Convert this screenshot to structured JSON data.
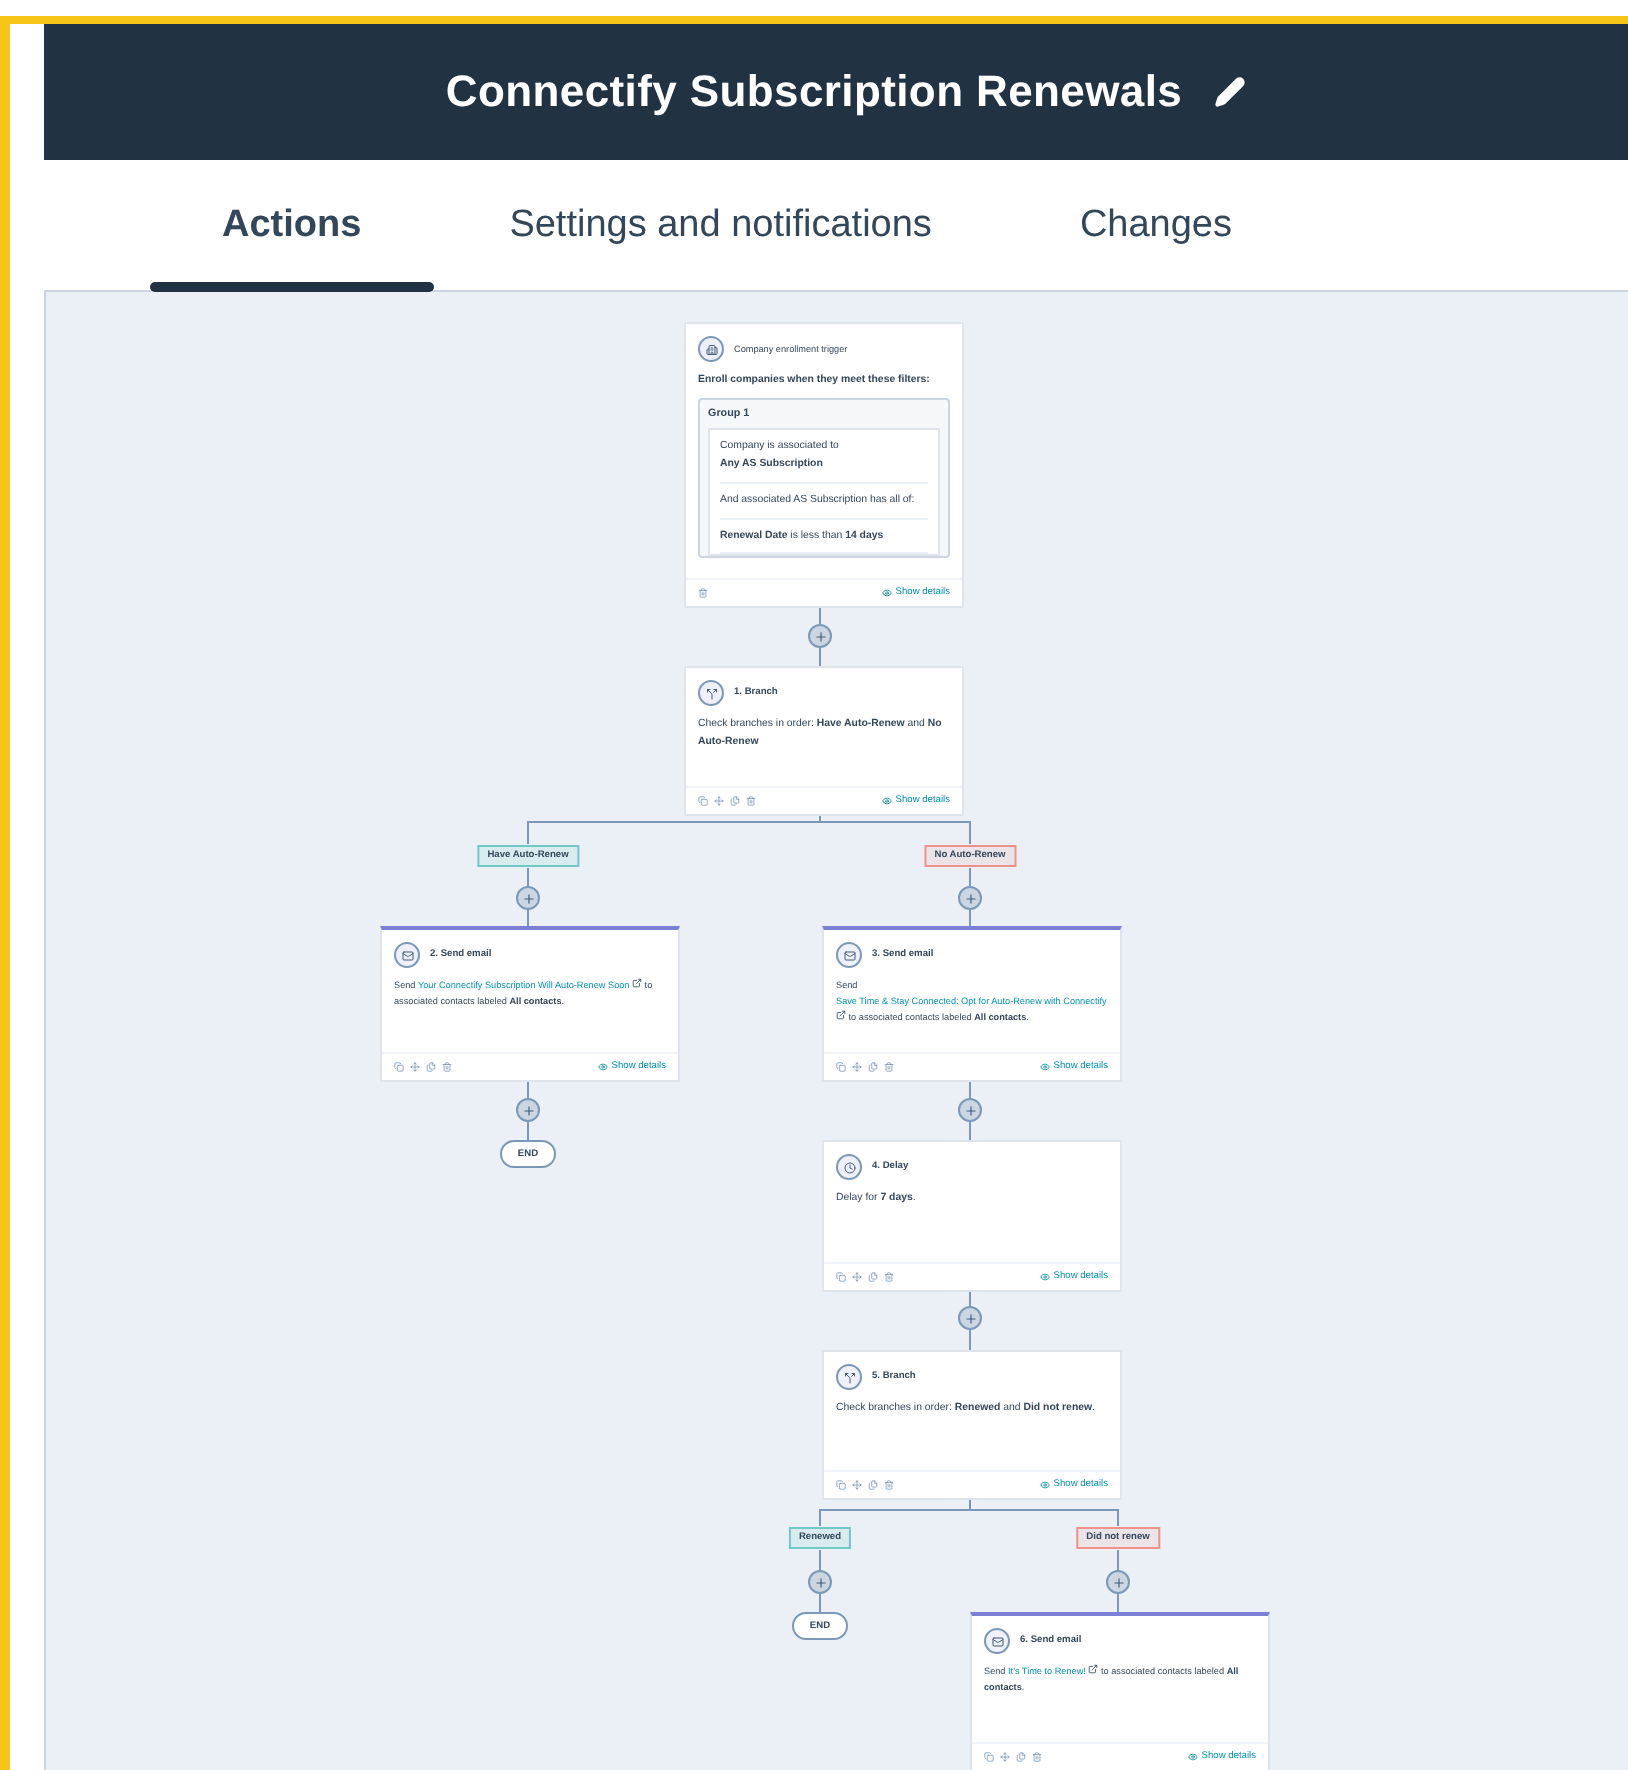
{
  "header": {
    "title": "Connectify Subscription Renewals"
  },
  "tabs": [
    {
      "label": "Actions",
      "selected": true
    },
    {
      "label": "Settings and notifications",
      "selected": false
    },
    {
      "label": "Changes",
      "selected": false
    }
  ],
  "workflow": {
    "trigger": {
      "title": "Company enrollment trigger",
      "intro": "Enroll companies when they meet these filters:",
      "group_title": "Group 1",
      "conditions": [
        {
          "label": "Company is associated to",
          "value": "Any AS Subscription"
        },
        {
          "label": "And associated AS Subscription has all of:"
        },
        {
          "label": "**Renewal Date** is less than **14 days**"
        }
      ],
      "action": "Show details"
    },
    "steps": [
      {
        "kind": "branch",
        "title": "1. Branch",
        "text": "Check branches in order: **Have Auto-Renew** and **No Auto-Renew**",
        "action": "Show details",
        "branches": [
          {
            "label": "Have Auto-Renew",
            "color": "#6fcac6"
          },
          {
            "label": "No Auto-Renew",
            "color": "#f0928a"
          }
        ]
      },
      {
        "kind": "email",
        "title": "2. Send email",
        "prefix": "Send",
        "link": "Your Connectify Subscription Will Auto-Renew Soon",
        "suffix": "to associated contacts labeled **All contacts**.",
        "action": "Show details"
      },
      {
        "kind": "email",
        "title": "3. Send email",
        "prefix": "Send",
        "link": "Save Time & Stay Connected: Opt for Auto-Renew with Connectify",
        "suffix": "to associated contacts labeled **All contacts**.",
        "action": "Show details"
      },
      {
        "kind": "delay",
        "title": "4. Delay",
        "text": "Delay for **7 days**.",
        "action": "Show details"
      },
      {
        "kind": "branch",
        "title": "5. Branch",
        "text": "Check branches in order: **Renewed** and **Did not renew**.",
        "action": "Show details",
        "branches": [
          {
            "label": "Renewed",
            "color": "#6fcac6"
          },
          {
            "label": "Did not renew",
            "color": "#f0928a"
          }
        ]
      },
      {
        "kind": "email",
        "title": "6. Send email",
        "prefix": "Send",
        "link": "It's Time to Renew!",
        "suffix": "to associated contacts labeled **All contacts**.",
        "action": "Show details"
      }
    ],
    "end_nodes": [
      "END",
      "END"
    ]
  }
}
